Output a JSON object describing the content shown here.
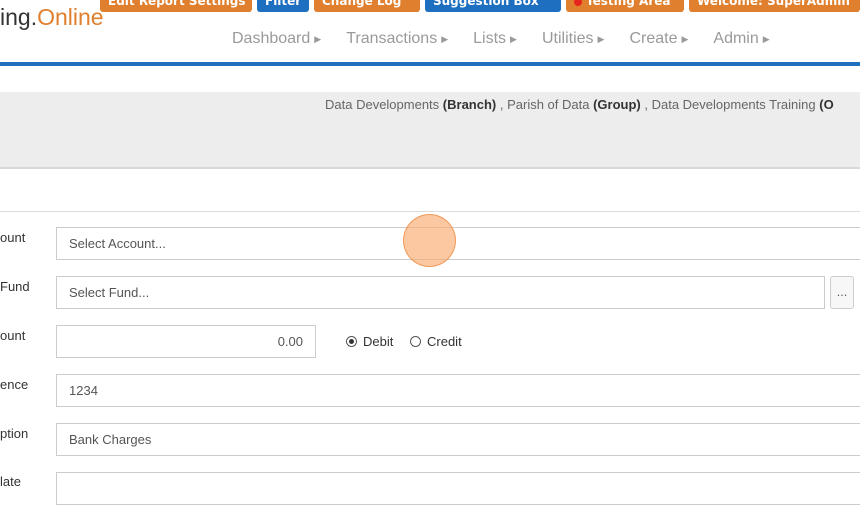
{
  "top_buttons": [
    {
      "label": "Edit Report Settings",
      "color": "orange"
    },
    {
      "label": "Filter",
      "color": "blue"
    },
    {
      "label": "Change Log",
      "color": "orange"
    },
    {
      "label": "Suggestion Box",
      "color": "blue"
    },
    {
      "label": "Testing Area",
      "color": "orange"
    },
    {
      "label": "Welcome: SuperAdmin",
      "color": "orange"
    }
  ],
  "logo": {
    "part1": "ing.",
    "part2": "Online"
  },
  "nav": [
    {
      "label": "Dashboard"
    },
    {
      "label": "Transactions"
    },
    {
      "label": "Lists"
    },
    {
      "label": "Utilities"
    },
    {
      "label": "Create"
    },
    {
      "label": "Admin"
    }
  ],
  "breadcrumb": {
    "branch_name": "Data Developments",
    "branch_type": "(Branch)",
    "group_name": "Parish of Data",
    "group_type": "(Group)",
    "org_name": "Data Developments Training",
    "org_type": "(O"
  },
  "form": {
    "account_label": "ount",
    "account_placeholder": "Select Account...",
    "fund_label": "Fund",
    "fund_placeholder": "Select Fund...",
    "fund_button": "...",
    "amount_label": "ount",
    "amount_value": "0.00",
    "debit_label": "Debit",
    "credit_label": "Credit",
    "reference_label": "ence",
    "reference_value": "1234",
    "description_label": "ption",
    "description_value": "Bank Charges",
    "date_label": "late"
  },
  "colors": {
    "accent_blue": "#1f6fc0",
    "accent_orange": "#e07f2e"
  }
}
